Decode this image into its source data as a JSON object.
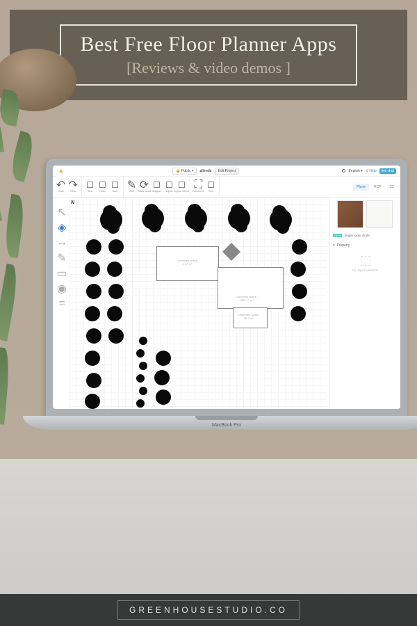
{
  "header": {
    "title": "Best Free Floor Planner Apps",
    "subtitle": "[Reviews & video demos ]"
  },
  "footer": {
    "brand": "GREENHOUSESTUDIO.CO"
  },
  "laptop": {
    "brand": "MacBook Pro"
  },
  "app": {
    "topbar": {
      "publish_label": "🔒 Public ▾",
      "project_name": "allende",
      "edit_label": "Edit Project",
      "language": "English ▾",
      "help_label": "⊘ Help",
      "livechat": "live chat"
    },
    "toolbar": {
      "groups": [
        [
          "Undo",
          "Redo"
        ],
        [
          "New",
          "Open",
          "Save"
        ],
        [
          "Edit",
          "Rotate Items",
          "Snapper",
          "Import",
          "Export Scene"
        ],
        [
          "Full screen",
          "Print"
        ]
      ],
      "view_tabs": [
        "Plane",
        "RCP",
        "3D"
      ],
      "active_view": "Plane"
    },
    "side_tools": [
      "cursor-icon",
      "select-icon",
      "measure-icon",
      "wall-icon",
      "room-icon",
      "camera-icon",
      "layers-icon"
    ],
    "canvas": {
      "compass": "N",
      "rooms": [
        {
          "name": "Unnamed space",
          "dimensions": "0.07 m²"
        },
        {
          "name": "Unnamed space",
          "dimensions": "1059.17 m²"
        },
        {
          "name": "Unnamed space",
          "dimensions": "18.3 m²"
        }
      ]
    },
    "right_panel": {
      "mode_new": "NEW",
      "mode_label": "Single room mode",
      "property_header": "Property",
      "empty_message": "No object selected."
    }
  }
}
